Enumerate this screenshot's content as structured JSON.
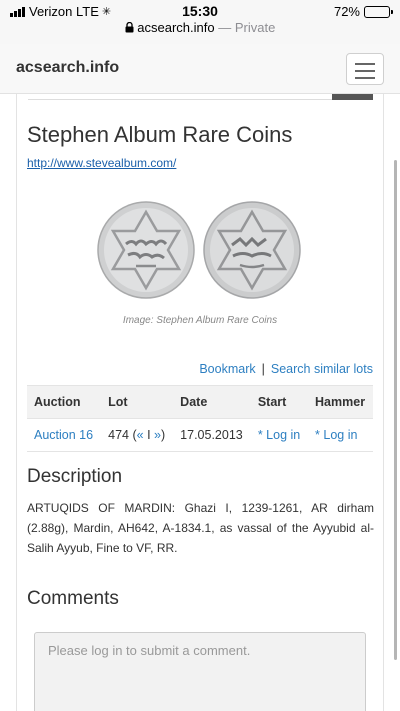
{
  "status": {
    "carrier": "Verizon",
    "network": "LTE",
    "time": "15:30",
    "battery": "72%",
    "battery_level": 0.72
  },
  "browser": {
    "host": "acsearch.info",
    "mode": "Private"
  },
  "header": {
    "brand": "acsearch.info"
  },
  "seller": {
    "name": "Stephen Album Rare Coins",
    "url": "http://www.stevealbum.com/"
  },
  "image": {
    "caption": "Image: Stephen Album Rare Coins"
  },
  "actions": {
    "bookmark": "Bookmark",
    "separator": "|",
    "search_similar": "Search similar lots"
  },
  "lot_table": {
    "headers": [
      "Auction",
      "Lot",
      "Date",
      "Start",
      "Hammer"
    ],
    "row": {
      "auction": "Auction 16",
      "lot": "474",
      "prev": "«",
      "nav_sep": "I",
      "next": "»",
      "date": "17.05.2013",
      "start": "* Log in",
      "hammer": "* Log in"
    }
  },
  "description": {
    "heading": "Description",
    "text": "ARTUQIDS OF MARDIN: Ghazi I, 1239-1261, AR dirham (2.88g), Mardin, AH642, A-1834.1, as vassal of the Ayyubid al-Salih Ayyub, Fine to VF, RR."
  },
  "comments": {
    "heading": "Comments",
    "placeholder": "Please log in to submit a comment."
  },
  "colors": {
    "link": "#2d7fc1",
    "battery_fill": "#f6c500"
  }
}
